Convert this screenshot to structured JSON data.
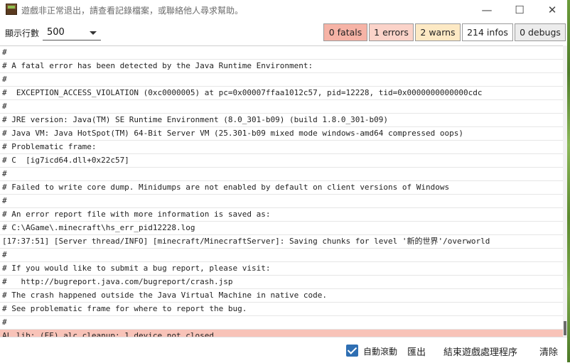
{
  "window": {
    "title": "遊戲非正常退出，請查看記錄檔案，或聯絡他人尋求幫助。",
    "minimize_glyph": "—",
    "maximize_glyph": "☐",
    "close_glyph": "✕",
    "icon": "minecraft-block-icon"
  },
  "toolbar": {
    "lines_label": "顯示行數",
    "lines_value": "500",
    "filters": {
      "fatal": "0 fatals",
      "error": "1 errors",
      "warn": "2 warns",
      "info": "214 infos",
      "debug": "0 debugs"
    }
  },
  "log_lines": [
    "#",
    "# A fatal error has been detected by the Java Runtime Environment:",
    "#",
    "#  EXCEPTION_ACCESS_VIOLATION (0xc0000005) at pc=0x00007ffaa1012c57, pid=12228, tid=0x0000000000000cdc",
    "#",
    "# JRE version: Java(TM) SE Runtime Environment (8.0_301-b09) (build 1.8.0_301-b09)",
    "# Java VM: Java HotSpot(TM) 64-Bit Server VM (25.301-b09 mixed mode windows-amd64 compressed oops)",
    "# Problematic frame:",
    "# C  [ig7icd64.dll+0x22c57]",
    "#",
    "# Failed to write core dump. Minidumps are not enabled by default on client versions of Windows",
    "#",
    "# An error report file with more information is saved as:",
    "# C:\\AGame\\.minecraft\\hs_err_pid12228.log",
    "[17:37:51] [Server thread/INFO] [minecraft/MinecraftServer]: Saving chunks for level '新的世界'/overworld",
    "#",
    "# If you would like to submit a bug report, please visit:",
    "#   http://bugreport.java.com/bugreport/crash.jsp",
    "# The crash happened outside the Java Virtual Machine in native code.",
    "# See problematic frame for where to report the bug.",
    "#",
    "AL lib: (EE) alc_cleanup: 1 device not closed"
  ],
  "highlight_line_index": 21,
  "bottom": {
    "autoscroll_label": "自動滾動",
    "autoscroll_checked": true,
    "export_label": "匯出",
    "kill_label": "結束遊戲處理程序",
    "clear_label": "清除"
  },
  "colors": {
    "fatal_bg": "#f6b3a6",
    "error_bg": "#fbd3c9",
    "warn_bg": "#fde9c4",
    "highlight_row": "#f8c3b8",
    "checkbox": "#2f6fb3"
  }
}
